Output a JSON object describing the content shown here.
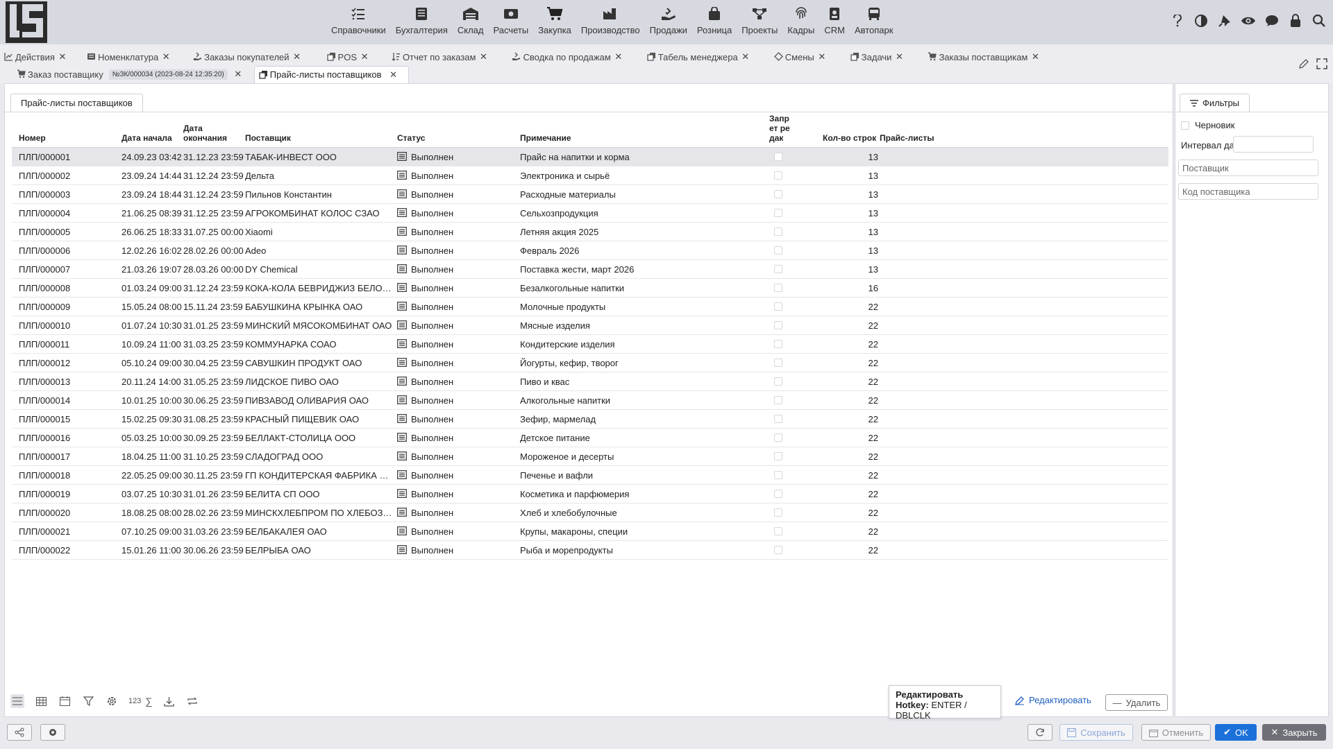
{
  "nav": [
    {
      "label": "Справочники",
      "icon": "list-check-icon"
    },
    {
      "label": "Бухгалтерия",
      "icon": "ledger-icon"
    },
    {
      "label": "Склад",
      "icon": "warehouse-icon"
    },
    {
      "label": "Расчеты",
      "icon": "money-icon"
    },
    {
      "label": "Закупка",
      "icon": "cart-icon"
    },
    {
      "label": "Производство",
      "icon": "factory-icon"
    },
    {
      "label": "Продажи",
      "icon": "hand-sale-icon"
    },
    {
      "label": "Розница",
      "icon": "shopping-bag-icon"
    },
    {
      "label": "Проекты",
      "icon": "project-nodes-icon"
    },
    {
      "label": "Кадры",
      "icon": "fingerprint-icon"
    },
    {
      "label": "CRM",
      "icon": "id-badge-icon"
    },
    {
      "label": "Автопарк",
      "icon": "bus-icon"
    }
  ],
  "right_icons": {
    "help": "?",
    "contrast": "◐",
    "pin": "📌",
    "eye": "◉",
    "chat": "●",
    "lock": "🔒",
    "search": "⌕"
  },
  "tabs_row1": [
    {
      "label": "Действия",
      "icon": "chart-line-icon"
    },
    {
      "label": "Номенклатура",
      "icon": "list-icon"
    },
    {
      "label": "Заказы покупателей",
      "icon": "hand-icon"
    },
    {
      "label": "POS",
      "icon": "copy-icon"
    },
    {
      "label": "Отчет по заказам",
      "icon": "sort-icon"
    },
    {
      "label": "Сводка по продажам",
      "icon": "hand-icon"
    },
    {
      "label": "Табель менеджера",
      "icon": "copy-icon"
    },
    {
      "label": "Смены",
      "icon": "diamond-icon"
    },
    {
      "label": "Задачи",
      "icon": "copy-icon"
    },
    {
      "label": "Заказы поставщикам",
      "icon": "cart-icon"
    }
  ],
  "tabs_row2": [
    {
      "label": "Заказ поставщику",
      "badge": "№ЗК/000034 (2023-08-24 12:35:20)",
      "icon": "cart-icon"
    },
    {
      "label": "Прайс-листы поставщиков",
      "icon": "copy-icon",
      "active": true
    }
  ],
  "panel_title": "Прайс-листы поставщиков",
  "columns": {
    "number": "Номер",
    "date_start": "Дата начала",
    "date_end": "Дата окончания",
    "supplier": "Поставщик",
    "status": "Статус",
    "note": "Примечание",
    "forbid": "Запрет редак",
    "rows_count": "Кол-во строк",
    "pricelists": "Прайс-листы"
  },
  "rows": [
    {
      "num": "ПЛП/000001",
      "start": "24.09.23 03:42",
      "end": "31.12.23 23:59",
      "supplier": "ТАБАК-ИНВЕСТ ООО",
      "status": "Выполнен",
      "note": "Прайс на напитки и корма",
      "count": "13"
    },
    {
      "num": "ПЛП/000002",
      "start": "23.09.24 14:44",
      "end": "31.12.24 23:59",
      "supplier": "Дельта",
      "status": "Выполнен",
      "note": "Электроника и сырьё",
      "count": "13"
    },
    {
      "num": "ПЛП/000003",
      "start": "23.09.24 18:44",
      "end": "31.12.24 23:59",
      "supplier": "Пильнов Константин",
      "status": "Выполнен",
      "note": "Расходные материалы",
      "count": "13"
    },
    {
      "num": "ПЛП/000004",
      "start": "21.06.25 08:39",
      "end": "31.12.25 23:59",
      "supplier": "АГРОКОМБИНАТ КОЛОС СЗАО",
      "status": "Выполнен",
      "note": "Сельхозпродукция",
      "count": "13"
    },
    {
      "num": "ПЛП/000005",
      "start": "26.06.25 18:33",
      "end": "31.07.25 00:00",
      "supplier": "Xiaomi",
      "status": "Выполнен",
      "note": "Летняя акция 2025",
      "count": "13"
    },
    {
      "num": "ПЛП/000006",
      "start": "12.02.26 16:02",
      "end": "28.02.26 00:00",
      "supplier": "Adeo",
      "status": "Выполнен",
      "note": "Февраль 2026",
      "count": "13"
    },
    {
      "num": "ПЛП/000007",
      "start": "21.03.26 19:07",
      "end": "28.03.26 00:00",
      "supplier": "DY Chemical",
      "status": "Выполнен",
      "note": "Поставка жести, март 2026",
      "count": "13"
    },
    {
      "num": "ПЛП/000008",
      "start": "01.03.24 09:00",
      "end": "31.12.24 23:59",
      "supplier": "КОКА-КОЛА БЕВРИДЖИЗ БЕЛОРУ...",
      "status": "Выполнен",
      "note": "Безалкогольные напитки",
      "count": "16"
    },
    {
      "num": "ПЛП/000009",
      "start": "15.05.24 08:00",
      "end": "15.11.24 23:59",
      "supplier": "БАБУШКИНА КРЫНКА ОАО",
      "status": "Выполнен",
      "note": "Молочные продукты",
      "count": "22"
    },
    {
      "num": "ПЛП/000010",
      "start": "01.07.24 10:30",
      "end": "31.01.25 23:59",
      "supplier": "МИНСКИЙ МЯСОКОМБИНАТ ОАО",
      "status": "Выполнен",
      "note": "Мясные изделия",
      "count": "22"
    },
    {
      "num": "ПЛП/000011",
      "start": "10.09.24 11:00",
      "end": "31.03.25 23:59",
      "supplier": "КОММУНАРКА СОАО",
      "status": "Выполнен",
      "note": "Кондитерские изделия",
      "count": "22"
    },
    {
      "num": "ПЛП/000012",
      "start": "05.10.24 09:00",
      "end": "30.04.25 23:59",
      "supplier": "САВУШКИН ПРОДУКТ ОАО",
      "status": "Выполнен",
      "note": "Йогурты, кефир, творог",
      "count": "22"
    },
    {
      "num": "ПЛП/000013",
      "start": "20.11.24 14:00",
      "end": "31.05.25 23:59",
      "supplier": "ЛИДСКОЕ ПИВО ОАО",
      "status": "Выполнен",
      "note": "Пиво и квас",
      "count": "22"
    },
    {
      "num": "ПЛП/000014",
      "start": "10.01.25 10:00",
      "end": "30.06.25 23:59",
      "supplier": "ПИВЗАВОД ОЛИВАРИЯ ОАО",
      "status": "Выполнен",
      "note": "Алкогольные напитки",
      "count": "22"
    },
    {
      "num": "ПЛП/000015",
      "start": "15.02.25 09:30",
      "end": "31.08.25 23:59",
      "supplier": "КРАСНЫЙ ПИЩЕВИК ОАО",
      "status": "Выполнен",
      "note": "Зефир, мармелад",
      "count": "22"
    },
    {
      "num": "ПЛП/000016",
      "start": "05.03.25 10:00",
      "end": "30.09.25 23:59",
      "supplier": "БЕЛЛАКТ-СТОЛИЦА ООО",
      "status": "Выполнен",
      "note": "Детское питание",
      "count": "22"
    },
    {
      "num": "ПЛП/000017",
      "start": "18.04.25 11:00",
      "end": "31.10.25 23:59",
      "supplier": "СЛАДОГРАД ООО",
      "status": "Выполнен",
      "note": "Мороженое и десерты",
      "count": "22"
    },
    {
      "num": "ПЛП/000018",
      "start": "22.05.25 09:00",
      "end": "30.11.25 23:59",
      "supplier": "ГП КОНДИТЕРСКАЯ ФАБРИКА ВИ...",
      "status": "Выполнен",
      "note": "Печенье и вафли",
      "count": "22"
    },
    {
      "num": "ПЛП/000019",
      "start": "03.07.25 10:30",
      "end": "31.01.26 23:59",
      "supplier": "БЕЛИТА СП ООО",
      "status": "Выполнен",
      "note": "Косметика и парфюмерия",
      "count": "22"
    },
    {
      "num": "ПЛП/000020",
      "start": "18.08.25 08:00",
      "end": "28.02.26 23:59",
      "supplier": "МИНСКХЛЕБПРОМ ПО ХЛЕБОЗАВ...",
      "status": "Выполнен",
      "note": "Хлеб и хлебобулочные",
      "count": "22"
    },
    {
      "num": "ПЛП/000021",
      "start": "07.10.25 09:00",
      "end": "31.03.26 23:59",
      "supplier": "БЕЛБАКАЛЕЯ ОАО",
      "status": "Выполнен",
      "note": "Крупы, макароны, специи",
      "count": "22"
    },
    {
      "num": "ПЛП/000022",
      "start": "15.01.26 11:00",
      "end": "30.06.26 23:59",
      "supplier": "БЕЛРЫБА ОАО",
      "status": "Выполнен",
      "note": "Рыба и морепродукты",
      "count": "22"
    }
  ],
  "toolbar": {
    "count_label": "123",
    "sum_label": "∑"
  },
  "tooltip": {
    "title": "Редактировать",
    "hotkey_label": "Hotkey:",
    "hotkey_value": "ENTER / DBLCLK"
  },
  "actions": {
    "edit": "Редактировать",
    "delete": "Удалить"
  },
  "filters": {
    "tab": "Фильтры",
    "draft": "Черновик",
    "date_interval": "Интервал дат",
    "supplier_placeholder": "Поставщик",
    "supplier_code_placeholder": "Код поставщика"
  },
  "footer": {
    "save": "Сохранить",
    "cancel": "Отменить",
    "ok": "OK",
    "close": "Закрыть"
  }
}
